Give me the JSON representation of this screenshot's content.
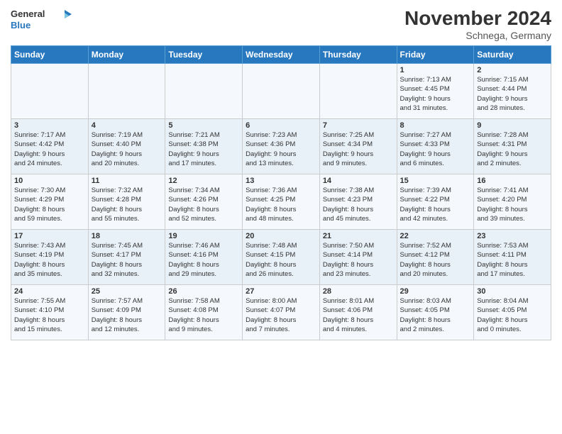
{
  "header": {
    "logo_general": "General",
    "logo_blue": "Blue",
    "title": "November 2024",
    "location": "Schnega, Germany"
  },
  "weekdays": [
    "Sunday",
    "Monday",
    "Tuesday",
    "Wednesday",
    "Thursday",
    "Friday",
    "Saturday"
  ],
  "weeks": [
    [
      {
        "day": "",
        "info": ""
      },
      {
        "day": "",
        "info": ""
      },
      {
        "day": "",
        "info": ""
      },
      {
        "day": "",
        "info": ""
      },
      {
        "day": "",
        "info": ""
      },
      {
        "day": "1",
        "info": "Sunrise: 7:13 AM\nSunset: 4:45 PM\nDaylight: 9 hours\nand 31 minutes."
      },
      {
        "day": "2",
        "info": "Sunrise: 7:15 AM\nSunset: 4:44 PM\nDaylight: 9 hours\nand 28 minutes."
      }
    ],
    [
      {
        "day": "3",
        "info": "Sunrise: 7:17 AM\nSunset: 4:42 PM\nDaylight: 9 hours\nand 24 minutes."
      },
      {
        "day": "4",
        "info": "Sunrise: 7:19 AM\nSunset: 4:40 PM\nDaylight: 9 hours\nand 20 minutes."
      },
      {
        "day": "5",
        "info": "Sunrise: 7:21 AM\nSunset: 4:38 PM\nDaylight: 9 hours\nand 17 minutes."
      },
      {
        "day": "6",
        "info": "Sunrise: 7:23 AM\nSunset: 4:36 PM\nDaylight: 9 hours\nand 13 minutes."
      },
      {
        "day": "7",
        "info": "Sunrise: 7:25 AM\nSunset: 4:34 PM\nDaylight: 9 hours\nand 9 minutes."
      },
      {
        "day": "8",
        "info": "Sunrise: 7:27 AM\nSunset: 4:33 PM\nDaylight: 9 hours\nand 6 minutes."
      },
      {
        "day": "9",
        "info": "Sunrise: 7:28 AM\nSunset: 4:31 PM\nDaylight: 9 hours\nand 2 minutes."
      }
    ],
    [
      {
        "day": "10",
        "info": "Sunrise: 7:30 AM\nSunset: 4:29 PM\nDaylight: 8 hours\nand 59 minutes."
      },
      {
        "day": "11",
        "info": "Sunrise: 7:32 AM\nSunset: 4:28 PM\nDaylight: 8 hours\nand 55 minutes."
      },
      {
        "day": "12",
        "info": "Sunrise: 7:34 AM\nSunset: 4:26 PM\nDaylight: 8 hours\nand 52 minutes."
      },
      {
        "day": "13",
        "info": "Sunrise: 7:36 AM\nSunset: 4:25 PM\nDaylight: 8 hours\nand 48 minutes."
      },
      {
        "day": "14",
        "info": "Sunrise: 7:38 AM\nSunset: 4:23 PM\nDaylight: 8 hours\nand 45 minutes."
      },
      {
        "day": "15",
        "info": "Sunrise: 7:39 AM\nSunset: 4:22 PM\nDaylight: 8 hours\nand 42 minutes."
      },
      {
        "day": "16",
        "info": "Sunrise: 7:41 AM\nSunset: 4:20 PM\nDaylight: 8 hours\nand 39 minutes."
      }
    ],
    [
      {
        "day": "17",
        "info": "Sunrise: 7:43 AM\nSunset: 4:19 PM\nDaylight: 8 hours\nand 35 minutes."
      },
      {
        "day": "18",
        "info": "Sunrise: 7:45 AM\nSunset: 4:17 PM\nDaylight: 8 hours\nand 32 minutes."
      },
      {
        "day": "19",
        "info": "Sunrise: 7:46 AM\nSunset: 4:16 PM\nDaylight: 8 hours\nand 29 minutes."
      },
      {
        "day": "20",
        "info": "Sunrise: 7:48 AM\nSunset: 4:15 PM\nDaylight: 8 hours\nand 26 minutes."
      },
      {
        "day": "21",
        "info": "Sunrise: 7:50 AM\nSunset: 4:14 PM\nDaylight: 8 hours\nand 23 minutes."
      },
      {
        "day": "22",
        "info": "Sunrise: 7:52 AM\nSunset: 4:12 PM\nDaylight: 8 hours\nand 20 minutes."
      },
      {
        "day": "23",
        "info": "Sunrise: 7:53 AM\nSunset: 4:11 PM\nDaylight: 8 hours\nand 17 minutes."
      }
    ],
    [
      {
        "day": "24",
        "info": "Sunrise: 7:55 AM\nSunset: 4:10 PM\nDaylight: 8 hours\nand 15 minutes."
      },
      {
        "day": "25",
        "info": "Sunrise: 7:57 AM\nSunset: 4:09 PM\nDaylight: 8 hours\nand 12 minutes."
      },
      {
        "day": "26",
        "info": "Sunrise: 7:58 AM\nSunset: 4:08 PM\nDaylight: 8 hours\nand 9 minutes."
      },
      {
        "day": "27",
        "info": "Sunrise: 8:00 AM\nSunset: 4:07 PM\nDaylight: 8 hours\nand 7 minutes."
      },
      {
        "day": "28",
        "info": "Sunrise: 8:01 AM\nSunset: 4:06 PM\nDaylight: 8 hours\nand 4 minutes."
      },
      {
        "day": "29",
        "info": "Sunrise: 8:03 AM\nSunset: 4:05 PM\nDaylight: 8 hours\nand 2 minutes."
      },
      {
        "day": "30",
        "info": "Sunrise: 8:04 AM\nSunset: 4:05 PM\nDaylight: 8 hours\nand 0 minutes."
      }
    ]
  ]
}
